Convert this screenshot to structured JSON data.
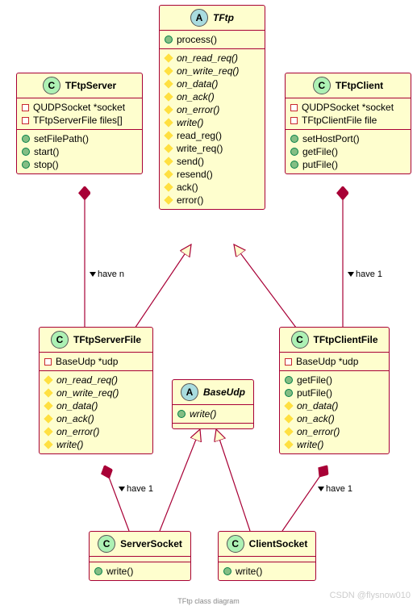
{
  "classes": {
    "TFtp": {
      "name": "TFtp",
      "stereotype": "A",
      "methods_public": [
        "process()"
      ],
      "methods_protected": [
        "on_read_req()",
        "on_write_req()",
        "on_data()",
        "on_ack()",
        "on_error()",
        "write()",
        "read_reg()",
        "write_req()",
        "send()",
        "resend()",
        "ack()",
        "error()"
      ]
    },
    "TFtpServer": {
      "name": "TFtpServer",
      "stereotype": "C",
      "attrs_private": [
        "QUDPSocket *socket",
        "TFtpServerFile files[]"
      ],
      "methods_public": [
        "setFilePath()",
        "start()",
        "stop()"
      ]
    },
    "TFtpClient": {
      "name": "TFtpClient",
      "stereotype": "C",
      "attrs_private": [
        "QUDPSocket *socket",
        "TFtpClientFile file"
      ],
      "methods_public": [
        "setHostPort()",
        "getFile()",
        "putFile()"
      ]
    },
    "TFtpServerFile": {
      "name": "TFtpServerFile",
      "stereotype": "C",
      "attrs_private": [
        "BaseUdp *udp"
      ],
      "methods_protected": [
        "on_read_req()",
        "on_write_req()",
        "on_data()",
        "on_ack()",
        "on_error()",
        "write()"
      ]
    },
    "TFtpClientFile": {
      "name": "TFtpClientFile",
      "stereotype": "C",
      "attrs_private": [
        "BaseUdp *udp"
      ],
      "methods_public": [
        "getFile()",
        "putFile()"
      ],
      "methods_protected": [
        "on_data()",
        "on_ack()",
        "on_error()",
        "write()"
      ]
    },
    "BaseUdp": {
      "name": "BaseUdp",
      "stereotype": "A",
      "methods_public": [
        "write()"
      ]
    },
    "ServerSocket": {
      "name": "ServerSocket",
      "stereotype": "C",
      "methods_public": [
        "write()"
      ]
    },
    "ClientSocket": {
      "name": "ClientSocket",
      "stereotype": "C",
      "methods_public": [
        "write()"
      ]
    }
  },
  "relations": [
    {
      "from": "TFtpServer",
      "to": "TFtpServerFile",
      "type": "composition",
      "label": "have n"
    },
    {
      "from": "TFtpClient",
      "to": "TFtpClientFile",
      "type": "composition",
      "label": "have 1"
    },
    {
      "from": "TFtpServerFile",
      "to": "TFtp",
      "type": "inherit"
    },
    {
      "from": "TFtpClientFile",
      "to": "TFtp",
      "type": "inherit"
    },
    {
      "from": "TFtpServerFile",
      "to": "ServerSocket",
      "type": "composition",
      "label": "have 1"
    },
    {
      "from": "TFtpClientFile",
      "to": "ClientSocket",
      "type": "composition",
      "label": "have 1"
    },
    {
      "from": "ServerSocket",
      "to": "BaseUdp",
      "type": "inherit"
    },
    {
      "from": "ClientSocket",
      "to": "BaseUdp",
      "type": "inherit"
    }
  ],
  "labels": {
    "have_n": "have n",
    "have_1": "have 1"
  },
  "caption": "TFtp class diagram",
  "watermark": "CSDN @flysnow010"
}
